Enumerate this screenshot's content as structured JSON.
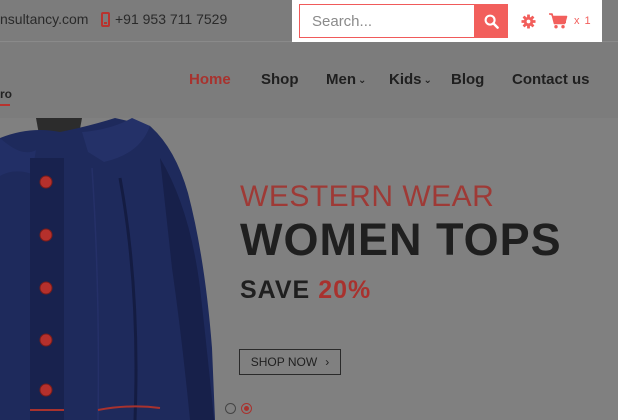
{
  "topbar": {
    "email_fragment": "nsultancy.com",
    "phone": "+91 953 711 7529"
  },
  "search": {
    "placeholder": "Search..."
  },
  "cart": {
    "count_label": "x 1"
  },
  "logo": {
    "fragment": "ro"
  },
  "nav": {
    "items": [
      {
        "label": "Home",
        "active": true
      },
      {
        "label": "Shop"
      },
      {
        "label": "Men",
        "dropdown": true
      },
      {
        "label": "Kids",
        "dropdown": true
      },
      {
        "label": "Blog"
      },
      {
        "label": "Contact us"
      }
    ]
  },
  "hero": {
    "eyebrow": "WESTERN WEAR",
    "headline": "WOMEN TOPS",
    "save_prefix": "SAVE",
    "save_percent": "20%",
    "cta_label": "SHOP NOW",
    "cta_arrow": "›"
  },
  "icons": {
    "search": "search-icon",
    "settings": "gear-icon",
    "cart": "cart-icon",
    "phone": "phone-icon"
  },
  "colors": {
    "accent": "#f25f5c",
    "brand_red": "#a8322e",
    "overlay_gray": "#7d7d7d"
  }
}
